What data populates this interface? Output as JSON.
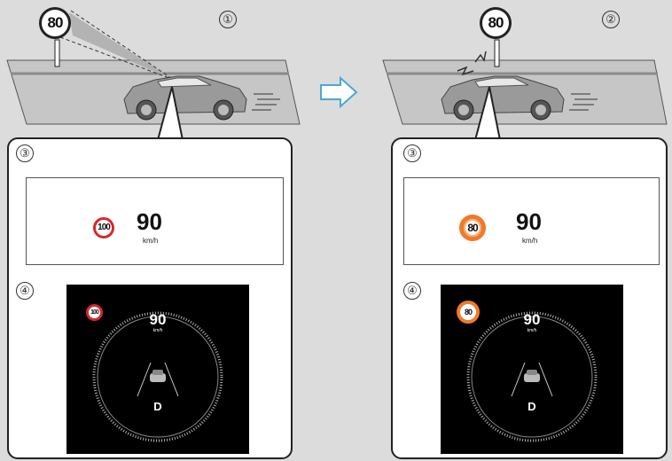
{
  "left": {
    "step_marker": "①",
    "road_sign": "80",
    "hud_marker": "③",
    "hud_sign": "100",
    "hud_speed": "90",
    "hud_unit": "km/h",
    "cluster_marker": "④",
    "cluster_sign": "100",
    "cluster_speed": "90",
    "cluster_unit": "km/h",
    "cluster_gear": "D"
  },
  "right": {
    "step_marker": "②",
    "road_sign": "80",
    "hud_marker": "③",
    "hud_sign": "80",
    "hud_speed": "90",
    "hud_unit": "km/h",
    "cluster_marker": "④",
    "cluster_sign": "80",
    "cluster_speed": "90",
    "cluster_unit": "km/h",
    "cluster_gear": "D"
  },
  "colors": {
    "arrow": "#4aa8d8",
    "warning_ring": "#f07a2a",
    "sign_ring": "#d9262c"
  }
}
